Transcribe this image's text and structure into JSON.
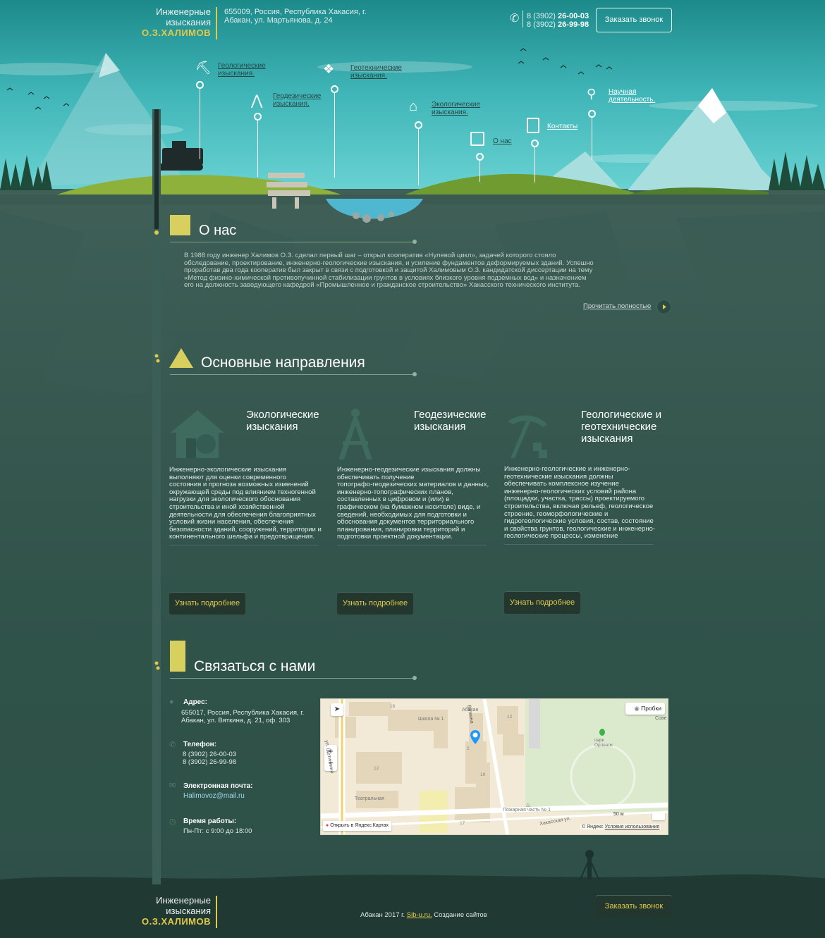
{
  "header": {
    "logo_line1": "Инженерные",
    "logo_line2": "изыскания",
    "logo_name": "О.З.ХАЛИМОВ",
    "address_line1": "655009, Россия, Республика Хакасия, г.",
    "address_line2": "Абакан, ул. Мартьянова, д. 24",
    "phone1_code": "8 (3902)",
    "phone1_num": "26-00-03",
    "phone2_code": "8 (3902)",
    "phone2_num": "26-99-98",
    "call_button": "Заказать звонок"
  },
  "nav": {
    "geological_1": "Геологические",
    "geological_2": "изыскания.",
    "geodetic_1": "Геодезические",
    "geodetic_2": "изыскания.",
    "geotechnical_1": "Геотехнические",
    "geotechnical_2": "изыскания.",
    "ecological_1": "Экологические",
    "ecological_2": "изыскания.",
    "about": "О нас",
    "contacts": "Контакты",
    "science_1": "Научная",
    "science_2": "деятельность."
  },
  "about": {
    "title": "О нас",
    "l1": "В 1988 году инженер Халимов О.З. сделал первый шаг – открыл кооператив «Нулевой цикл», задачей которого стояло",
    "l2": "обследование, проектирование, инженерно-геологические изыскания, и усиление фундаментов деформируемых зданий. Успешно",
    "l3": "проработав два года кооператив был закрыт в связи с подготовкой и защитой Халимовым О.З. кандидатской диссертации на тему",
    "l4": "«Метод физико-химической противопучинной стабилизации грунтов в условиях близкого уровня подземных вод» и назначением",
    "l5": "его на должность заведующего кафедрой «Промышленное и гражданское строительство» Хакасского технического института.",
    "read_more": "Прочитать полностью"
  },
  "directions": {
    "title": "Основные направления",
    "items": [
      {
        "title1": "Экологические",
        "title2": "изыскания",
        "title3": "",
        "text": [
          "Инженерно-экологические изыскания",
          "выполняют для оценки современного",
          "состояния и прогноза возможных изменений",
          "окружающей среды под влиянием техногенной",
          "нагрузки для экологического обоснования",
          "строительства и иной хозяйственной",
          "деятельности для обеспечения благоприятных",
          "условий жизни населения, обеспечения",
          "безопасности зданий, сооружений, территории и",
          "континентального шельфа и предотвращения."
        ],
        "button": "Узнать подробнее"
      },
      {
        "title1": "Геодезические",
        "title2": "изыскания",
        "title3": "",
        "text": [
          "Инженерно-геодезические изыскания должны",
          "обеспечивать получение",
          "топографо-геодезических материалов и данных,",
          "инженерно-топографических планов,",
          "составленных в цифровом и (или) в",
          "графическом (на бумажном носителе) виде, и",
          "сведений, необходимых для подготовки и",
          "обоснования документов территориального",
          "планирования, планировки территорий и",
          "подготовки проектной документации."
        ],
        "button": "Узнать подробнее"
      },
      {
        "title1": "Геологические и",
        "title2": "геотехнические",
        "title3": "изыскания",
        "text": [
          "Инженерно-геологические и инженерно-",
          "геотехнические изыскания должны",
          "обеспечивать комплексное изучение",
          "инженерно-геологических условий района",
          "(площадки, участка, трассы) проектируемого",
          "строительства, включая рельеф, геологическое",
          "строение, геоморфологические и",
          "гидрогеологические условия, состав, состояние",
          "и свойства грунтов, геологические и инженерно-",
          "геологические процессы, изменение"
        ],
        "button": "Узнать подробнее"
      }
    ]
  },
  "contacts": {
    "title": "Связаться с нами",
    "address_label": "Адрес:",
    "address_l1": "655017, Россия, Республика Хакасия, г.",
    "address_l2": "Абакан, ул. Вяткина, д. 21, оф. 303",
    "phone_label": "Телефон:",
    "phone1": "8 (3902) 26-00-03",
    "phone2": "8 (3902) 26-99-98",
    "email_label": "Электронная почта:",
    "email": "Halimovoz@mail.ru",
    "hours_label": "Время работы:",
    "hours": "Пн-Пт: с 9:00 до 18:00"
  },
  "map": {
    "traffic": "Пробки",
    "open_in": "Открыть в Яндекс.Картах",
    "copyright": "© Яндекс",
    "terms": "Условия использования",
    "scale": "50 м",
    "labels": {
      "school": "Школа № 1",
      "abakan": "Абакан",
      "vyatkina": "Вяткина",
      "park": "парк",
      "park2": "Орленок",
      "fire": "Пожарная часть № 1",
      "teatr": "Театральная",
      "hakas": "Хакасская ул.",
      "sove": "Сове",
      "street_left": "ул. Щетинкина",
      "n12a": "12",
      "n12b": "12",
      "n19": "19",
      "n17": "17",
      "n16": "16",
      "n2": "2"
    }
  },
  "footer": {
    "logo_line1": "Инженерные",
    "logo_line2": "изыскания",
    "logo_name": "О.З.ХАЛИМОВ",
    "copy_pre": "Абакан 2017 г.",
    "copy_link": "Sib-u.ru.",
    "copy_post": "Создание сайтов",
    "call_button": "Заказать звонок"
  },
  "colors": {
    "accent": "#e2c94a",
    "ground": "#2f5249",
    "sky": "#4fc7c9"
  }
}
